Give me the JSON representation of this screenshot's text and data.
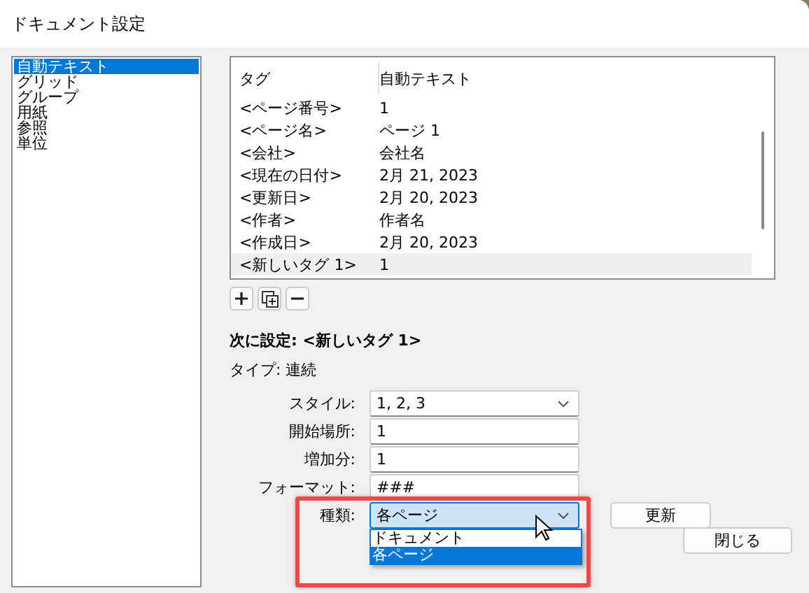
{
  "window": {
    "title": "ドキュメント設定"
  },
  "sidebar": {
    "items": [
      {
        "label": "自動テキスト",
        "selected": true
      },
      {
        "label": "グリッド",
        "selected": false
      },
      {
        "label": "グループ",
        "selected": false
      },
      {
        "label": "用紙",
        "selected": false
      },
      {
        "label": "参照",
        "selected": false
      },
      {
        "label": "単位",
        "selected": false
      }
    ]
  },
  "table": {
    "columns": [
      "タグ",
      "自動テキスト"
    ],
    "rows": [
      {
        "tag": "<ページ番号>",
        "value": "1",
        "selected": false
      },
      {
        "tag": "<ページ名>",
        "value": "ページ 1",
        "selected": false
      },
      {
        "tag": "<会社>",
        "value": "会社名",
        "selected": false
      },
      {
        "tag": "<現在の日付>",
        "value": "2月 21, 2023",
        "selected": false
      },
      {
        "tag": "<更新日>",
        "value": "2月 20, 2023",
        "selected": false
      },
      {
        "tag": "<作者>",
        "value": "作者名",
        "selected": false
      },
      {
        "tag": "<作成日>",
        "value": "2月 20, 2023",
        "selected": false
      },
      {
        "tag": "<新しいタグ 1>",
        "value": "1",
        "selected": true
      }
    ]
  },
  "detail": {
    "heading": "次に設定: <新しいタグ 1>",
    "type_line": "タイプ: 連続",
    "fields": [
      {
        "label": "スタイル:",
        "value": "1, 2, 3",
        "kind": "select"
      },
      {
        "label": "開始場所:",
        "value": "1",
        "kind": "text"
      },
      {
        "label": "増加分:",
        "value": "1",
        "kind": "text"
      },
      {
        "label": "フォーマット:",
        "value": "###",
        "kind": "text"
      },
      {
        "label": "種類:",
        "value": "各ページ",
        "kind": "open-select",
        "options": [
          {
            "label": "ドキュメント",
            "selected": false
          },
          {
            "label": "各ページ",
            "selected": true
          }
        ]
      }
    ]
  },
  "buttons": {
    "update": "更新",
    "close": "閉じる"
  }
}
